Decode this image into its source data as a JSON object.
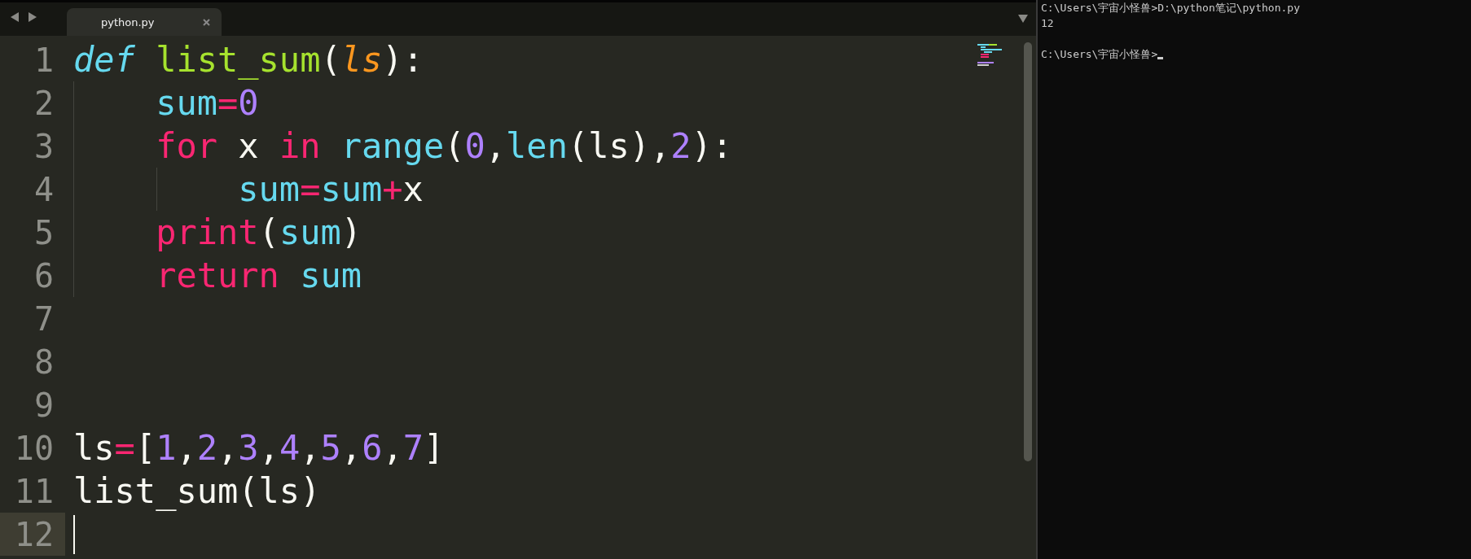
{
  "editor": {
    "tabs": [
      {
        "label": "python.py",
        "selected": true
      }
    ],
    "lines": [
      {
        "number": "1",
        "current": false,
        "tokens": [
          {
            "kind": "storage",
            "t": "def "
          },
          {
            "kind": "function",
            "t": "list_sum"
          },
          {
            "kind": "plain",
            "t": "("
          },
          {
            "kind": "param",
            "t": "ls"
          },
          {
            "kind": "plain",
            "t": "):"
          }
        ]
      },
      {
        "number": "2",
        "current": false,
        "tokens": [
          {
            "kind": "builtin",
            "t": "    sum"
          },
          {
            "kind": "operator",
            "t": "="
          },
          {
            "kind": "number",
            "t": "0"
          }
        ]
      },
      {
        "number": "3",
        "current": false,
        "tokens": [
          {
            "kind": "keyword",
            "t": "    for"
          },
          {
            "kind": "plain",
            "t": " x "
          },
          {
            "kind": "keyword",
            "t": "in "
          },
          {
            "kind": "builtin",
            "t": "range"
          },
          {
            "kind": "plain",
            "t": "("
          },
          {
            "kind": "number",
            "t": "0"
          },
          {
            "kind": "plain",
            "t": ","
          },
          {
            "kind": "builtin",
            "t": "len"
          },
          {
            "kind": "plain",
            "t": "(ls),"
          },
          {
            "kind": "number",
            "t": "2"
          },
          {
            "kind": "plain",
            "t": "):"
          }
        ]
      },
      {
        "number": "4",
        "current": false,
        "tokens": [
          {
            "kind": "builtin",
            "t": "        sum"
          },
          {
            "kind": "operator",
            "t": "="
          },
          {
            "kind": "builtin",
            "t": "sum"
          },
          {
            "kind": "operator",
            "t": "+"
          },
          {
            "kind": "plain",
            "t": "x"
          }
        ]
      },
      {
        "number": "5",
        "current": false,
        "tokens": [
          {
            "kind": "keyword",
            "t": "    print"
          },
          {
            "kind": "plain",
            "t": "("
          },
          {
            "kind": "builtin",
            "t": "sum"
          },
          {
            "kind": "plain",
            "t": ")"
          }
        ]
      },
      {
        "number": "6",
        "current": false,
        "tokens": [
          {
            "kind": "keyword",
            "t": "    return "
          },
          {
            "kind": "builtin",
            "t": "sum"
          }
        ]
      },
      {
        "number": "7",
        "current": false
      },
      {
        "number": "8",
        "current": false
      },
      {
        "number": "9",
        "current": false
      },
      {
        "number": "10",
        "current": false,
        "tokens": [
          {
            "kind": "plain",
            "t": "ls"
          },
          {
            "kind": "operator",
            "t": "="
          },
          {
            "kind": "plain",
            "t": "["
          },
          {
            "kind": "number",
            "t": "1"
          },
          {
            "kind": "plain",
            "t": ","
          },
          {
            "kind": "number",
            "t": "2"
          },
          {
            "kind": "plain",
            "t": ","
          },
          {
            "kind": "number",
            "t": "3"
          },
          {
            "kind": "plain",
            "t": ","
          },
          {
            "kind": "number",
            "t": "4"
          },
          {
            "kind": "plain",
            "t": ","
          },
          {
            "kind": "number",
            "t": "5"
          },
          {
            "kind": "plain",
            "t": ","
          },
          {
            "kind": "number",
            "t": "6"
          },
          {
            "kind": "plain",
            "t": ","
          },
          {
            "kind": "number",
            "t": "7"
          },
          {
            "kind": "plain",
            "t": "]"
          }
        ]
      },
      {
        "number": "11",
        "current": false,
        "tokens": [
          {
            "kind": "plain",
            "t": "list_sum(ls)"
          }
        ]
      },
      {
        "number": "12",
        "current": true
      }
    ]
  },
  "terminal": {
    "blocks": [
      {
        "lines": [
          "C:\\Users\\宇宙小怪兽>D:\\python笔记\\python.py",
          "12"
        ]
      },
      {
        "lines": [
          "C:\\Users\\宇宙小怪兽>"
        ]
      }
    ]
  }
}
